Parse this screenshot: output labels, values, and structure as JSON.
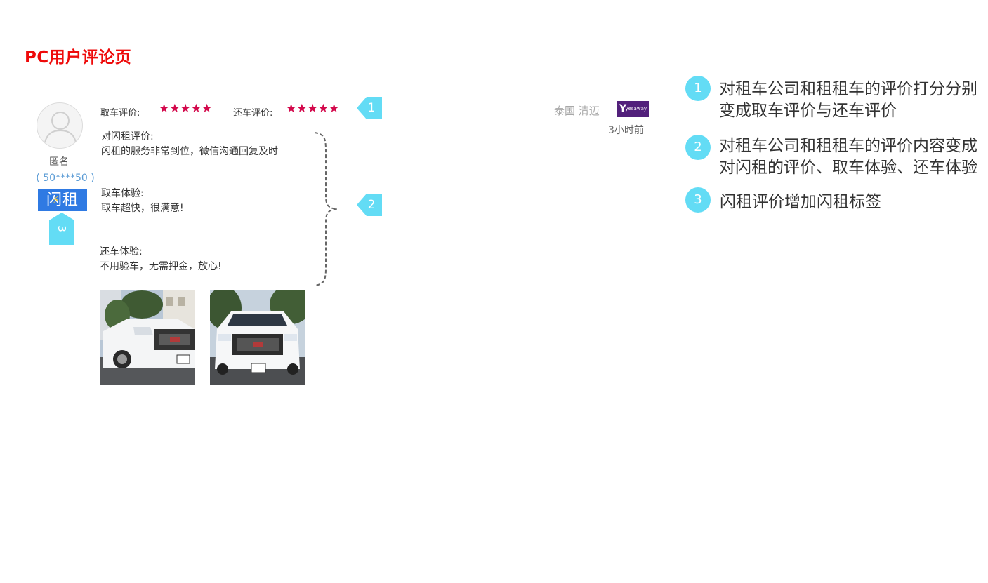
{
  "page": {
    "title": "PC用户评论页"
  },
  "review": {
    "user": {
      "name": "匿名",
      "id": "( 50****50 )",
      "brand_tag": "闪租"
    },
    "pickup_rating": {
      "label": "取车评价:",
      "stars": 5
    },
    "return_rating": {
      "label": "还车评价:",
      "stars": 5
    },
    "location": "泰国 清迈",
    "time_ago": "3小时前",
    "provider_logo": "yesaway",
    "sections": [
      {
        "title": "对闪租评价:",
        "body": "闪租的服务非常到位，微信沟通回复及时"
      },
      {
        "title": "取车体验:",
        "body": "取车超快，很满意!"
      },
      {
        "title": "还车体验:",
        "body": "不用验车，无需押金，放心!"
      }
    ],
    "photos": [
      "car-photo-1",
      "car-photo-2"
    ]
  },
  "callouts": {
    "c1": "1",
    "c2": "2",
    "c3": "3"
  },
  "notes": [
    {
      "num": "1",
      "text": "对租车公司和租租车的评价打分分别变成取车评价与还车评价"
    },
    {
      "num": "2",
      "text": "对租车公司和租租车的评价内容变成对闪租的评价、取车体验、还车体验"
    },
    {
      "num": "3",
      "text": "闪租评价增加闪租标签"
    }
  ],
  "colors": {
    "title_red": "#ee0a0a",
    "star_red": "#d3084b",
    "callout_cyan": "#63dcf5",
    "brand_blue": "#2f7ae3",
    "provider_purple": "#52207b",
    "user_id_blue": "#5a9bd5"
  }
}
